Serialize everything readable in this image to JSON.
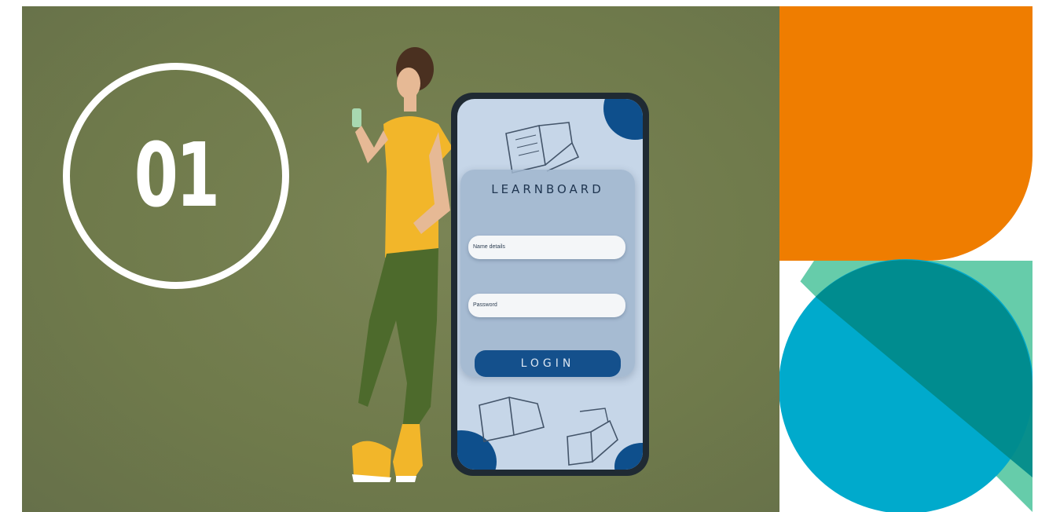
{
  "step": {
    "number": "01"
  },
  "login": {
    "brand": "LEARNBOARD",
    "username_placeholder": "Name details",
    "password_placeholder": "Password",
    "button_label": "LOGIN"
  },
  "colors": {
    "background_olive": "#6f7a4b",
    "orange": "#ef7d00",
    "teal_light": "#66ccaa",
    "teal_dark": "#008a8a",
    "cyan": "#00aacc",
    "phone_blue": "#14508c"
  },
  "icons": [
    "open-book-icon"
  ]
}
